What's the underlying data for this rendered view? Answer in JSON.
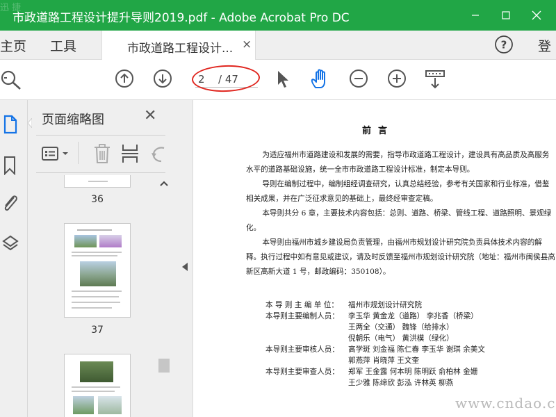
{
  "window": {
    "title": "市政道路工程设计提升导则2019.pdf - Adobe Acrobat Pro DC",
    "corner_watermark": "迅 捷"
  },
  "menubar": {
    "home": "主页",
    "tools": "工具",
    "tab_label": "市政道路工程设计...",
    "tab_close": "×",
    "help": "?",
    "signin": "登"
  },
  "toolbar": {
    "current_page": "2",
    "total_pages": "/ 47",
    "icons": [
      "search-icon",
      "previous-page-icon",
      "next-page-icon",
      "select-arrow-icon",
      "hand-tool-icon",
      "zoom-out-icon",
      "zoom-in-icon",
      "scroll-mode-icon"
    ],
    "accent_color": "#1473e6",
    "highlight_color": "#e0261f"
  },
  "rail": {
    "icons": [
      "page-thumbnails-icon",
      "bookmark-icon",
      "attachment-icon",
      "layers-icon"
    ]
  },
  "thumbnails": {
    "title": "页面缩略图",
    "close": "✕",
    "pages": [
      "36",
      "37"
    ],
    "icons": [
      "thumbnail-options-icon",
      "delete-page-icon",
      "insert-page-icon",
      "undo-icon"
    ]
  },
  "document": {
    "heading": "前言",
    "paragraphs": [
      "为适应福州市道路建设和发展的需要，指导市政道路工程设计，建设具有高品质及高服务水平的道路基础设施，统一全市市政道路工程设计标准，制定本导则。",
      "导则在编制过程中，编制组经调查研究，认真总结经验，参考有关国家和行业标准，借鉴相关成果，并在广泛征求意见的基础上，最终经审查定稿。",
      "本导则共分 6 章，主要技术内容包括：总则、道路、桥梁、管线工程、道路照明、景观绿化。",
      "本导则由福州市城乡建设局负责管理，由福州市规划设计研究院负责具体技术内容的解释。执行过程中如有意见或建议，请及时反馈至福州市规划设计研究院（地址：福州市闽侯县高新区高新大道 1 号，邮政编码：350108）。"
    ],
    "staff": [
      {
        "label": "本 导 则 主 编 单 位：",
        "value": "福州市规划设计研究院"
      },
      {
        "label": "本导则主要编制人员：",
        "value": "李玉华  黄金龙（道路）  李兆香（桥梁）"
      },
      {
        "label": "",
        "value": "王两全（交通）  魏锋（给排水）"
      },
      {
        "label": "",
        "value": "倪朝乐（电气）  黄洪模（绿化）"
      },
      {
        "label": "本导则主要审核人员：",
        "value": "高学斑  刘金福  陈仁春  李玉华  谢琪  余美文"
      },
      {
        "label": "",
        "value": "郭燕萍  肖晓萍  王文奎"
      },
      {
        "label": "本导则主要审查人员：",
        "value": "郑军  王金露  何本明  陈明跃  俞柏林  金姗"
      },
      {
        "label": "",
        "value": "王少雅  陈缔欣  彭泓  许林英  柳燕"
      }
    ]
  },
  "site_watermark": "www.cndao.com"
}
